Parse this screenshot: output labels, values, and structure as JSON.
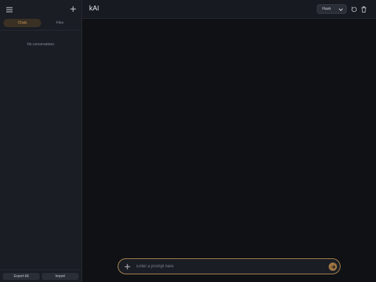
{
  "sidebar": {
    "tabs": [
      {
        "label": "Chats",
        "active": true
      },
      {
        "label": "Files",
        "active": false
      }
    ],
    "empty_text": "No conversations",
    "export_label": "Export All",
    "import_label": "Import"
  },
  "header": {
    "title": "kAI",
    "model": "Flash"
  },
  "prompt": {
    "placeholder": "Enter a prompt here"
  },
  "icons": {
    "menu": "menu-icon",
    "new_chat": "plus-icon",
    "model_dropdown": "chevron-down-icon",
    "refresh": "refresh-icon",
    "delete": "trash-icon",
    "attach": "plus-icon",
    "send": "arrow-right-icon"
  },
  "colors": {
    "accent": "#d09a5c",
    "send_button": "#9c7443",
    "prompt_border": "#b08a52",
    "background": "#101114",
    "sidebar": "#1a1d24"
  }
}
